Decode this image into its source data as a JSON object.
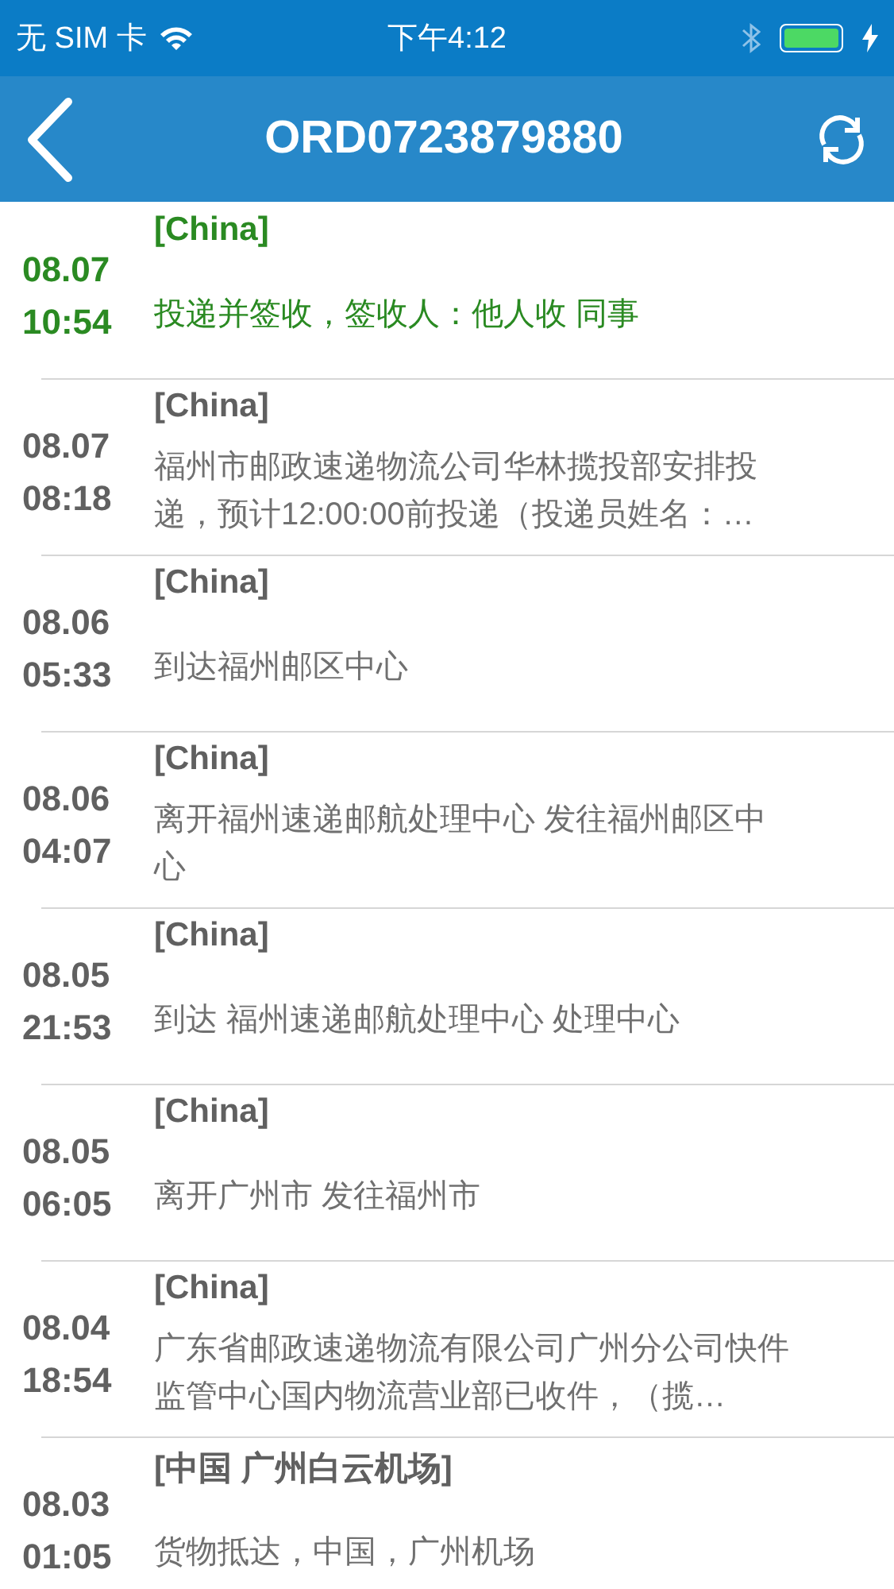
{
  "status_bar": {
    "carrier": "无 SIM 卡",
    "time": "下午4:12"
  },
  "nav": {
    "title": "ORD0723879880"
  },
  "events": [
    {
      "date": "08.07",
      "time": "10:54",
      "location": "[China]",
      "description": "投递并签收，签收人：他人收 同事",
      "selected": true
    },
    {
      "date": "08.07",
      "time": "08:18",
      "location": "[China]",
      "description": "福州市邮政速递物流公司华林揽投部安排投递，预计12:00:00前投递（投递员姓名：…",
      "selected": false
    },
    {
      "date": "08.06",
      "time": "05:33",
      "location": "[China]",
      "description": "到达福州邮区中心",
      "selected": false
    },
    {
      "date": "08.06",
      "time": "04:07",
      "location": "[China]",
      "description": "离开福州速递邮航处理中心 发往福州邮区中心",
      "selected": false
    },
    {
      "date": "08.05",
      "time": "21:53",
      "location": "[China]",
      "description": "到达  福州速递邮航处理中心 处理中心",
      "selected": false
    },
    {
      "date": "08.05",
      "time": "06:05",
      "location": "[China]",
      "description": "离开广州市 发往福州市",
      "selected": false
    },
    {
      "date": "08.04",
      "time": "18:54",
      "location": "[China]",
      "description": "广东省邮政速递物流有限公司广州分公司快件监管中心国内物流营业部已收件，（揽…",
      "selected": false
    },
    {
      "date": "08.03",
      "time": "01:05",
      "location": "[中国 广州白云机场]",
      "description": "货物抵达，中国，广州机场",
      "selected": false
    }
  ]
}
